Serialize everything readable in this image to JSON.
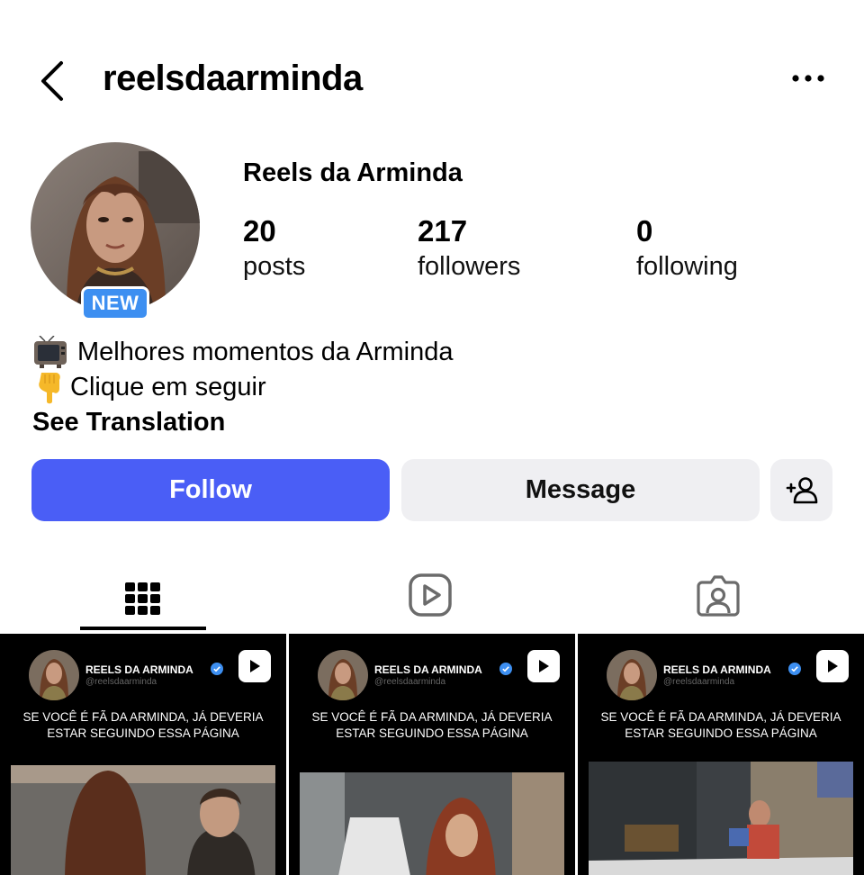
{
  "header": {
    "username": "reelsdaarminda"
  },
  "profile": {
    "display_name": "Reels da Arminda",
    "new_badge": "NEW",
    "stats": [
      {
        "number": "20",
        "label": "posts"
      },
      {
        "number": "217",
        "label": "followers"
      },
      {
        "number": "0",
        "label": "following"
      }
    ],
    "bio": {
      "line1": "Melhores momentos da Arminda",
      "line2": "Clique em seguir",
      "see_translation": "See Translation"
    }
  },
  "actions": {
    "follow": "Follow",
    "message": "Message"
  },
  "tabs": [
    "grid",
    "reels",
    "tagged"
  ],
  "posts": [
    {
      "name": "REELS DA ARMINDA",
      "handle": "@reelsdaarminda",
      "caption_line1": "SE VOCÊ É FÃ DA ARMINDA, JÁ DEVERIA",
      "caption_line2": "ESTAR SEGUINDO ESSA PÁGINA"
    },
    {
      "name": "REELS DA ARMINDA",
      "handle": "@reelsdaarminda",
      "caption_line1": "SE VOCÊ É FÃ DA ARMINDA, JÁ DEVERIA",
      "caption_line2": "ESTAR SEGUINDO ESSA PÁGINA"
    },
    {
      "name": "REELS DA ARMINDA",
      "handle": "@reelsdaarminda",
      "caption_line1": "SE VOCÊ É FÃ DA ARMINDA, JÁ DEVERIA",
      "caption_line2": "ESTAR SEGUINDO ESSA PÁGINA"
    }
  ],
  "colors": {
    "follow_button": "#4a5ef6",
    "secondary_button": "#efeff2",
    "new_badge": "#3d8ff1",
    "verified": "#3d8ff1"
  },
  "icons": {
    "back": "chevron-left-icon",
    "more": "more-horizontal-icon",
    "add_user": "add-user-icon",
    "grid_tab": "grid-icon",
    "reels_tab": "reels-icon",
    "tagged_tab": "tagged-icon",
    "bio_emoji_1": "television-emoji",
    "bio_emoji_2": "pointing-down-emoji"
  }
}
